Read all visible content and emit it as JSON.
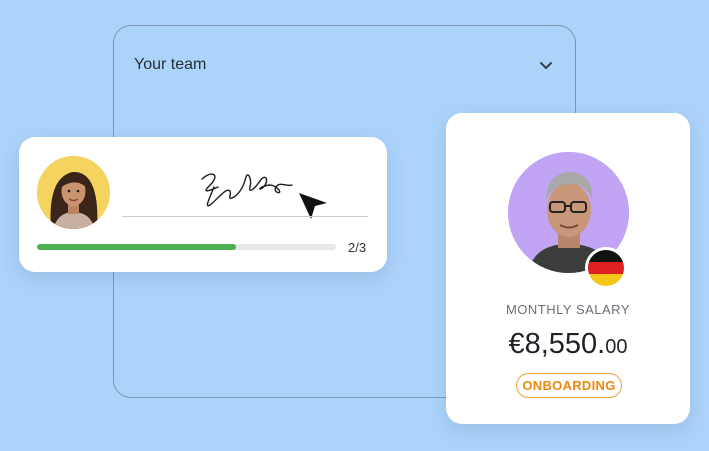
{
  "team_panel": {
    "title": "Your team",
    "chevron_icon": "chevron-down-icon"
  },
  "signature_card": {
    "avatar": "woman-avatar",
    "signature": "handwritten-signature",
    "cursor_icon": "cursor-arrow-icon",
    "progress": {
      "value": 2,
      "total": 3,
      "label": "2/3",
      "color": "#4caf50"
    }
  },
  "salary_card": {
    "avatar": "man-avatar",
    "flag": "germany-flag-icon",
    "label": "MONTHLY SALARY",
    "amount_main": "€8,550.",
    "amount_cents": "00",
    "status": "ONBOARDING",
    "status_color": "#ea8a10"
  }
}
